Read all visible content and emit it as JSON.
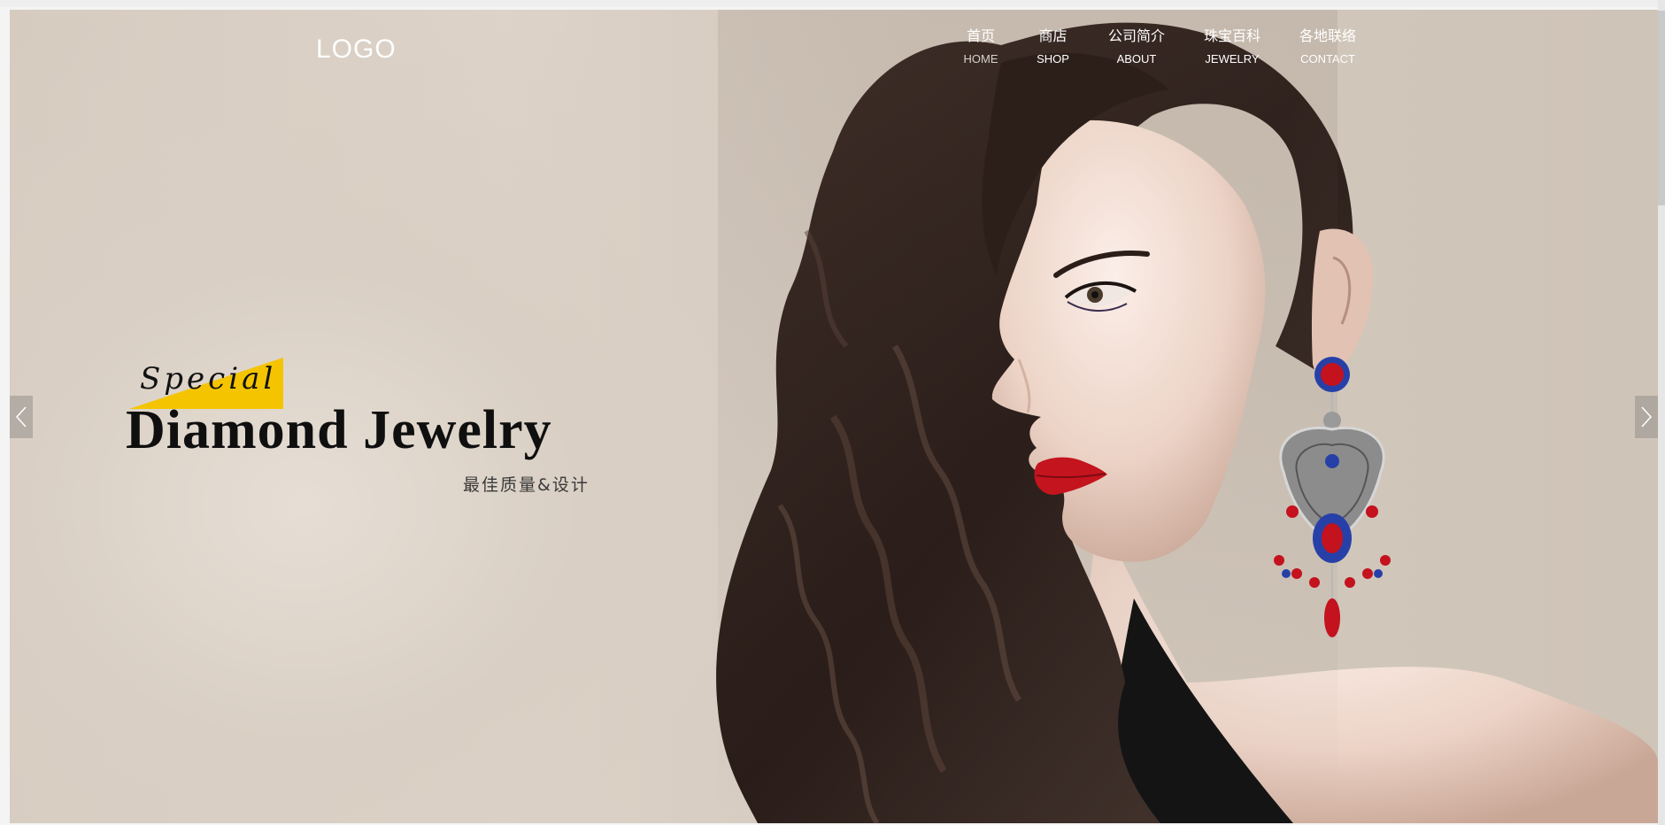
{
  "header": {
    "logo_text": "LOGO",
    "nav": [
      {
        "zh": "首页",
        "en": "HOME",
        "active": true
      },
      {
        "zh": "商店",
        "en": "SHOP",
        "active": false
      },
      {
        "zh": "公司简介",
        "en": "ABOUT",
        "active": false
      },
      {
        "zh": "珠宝百科",
        "en": "JEWELRY",
        "active": false
      },
      {
        "zh": "各地联络",
        "en": "CONTACT",
        "active": false
      }
    ]
  },
  "hero": {
    "tag": "Special",
    "headline": "Diamond Jewelry",
    "subline": "最佳质量&设计",
    "accent_color": "#f5c400",
    "prev_icon": "chevron-left-icon",
    "next_icon": "chevron-right-icon"
  }
}
